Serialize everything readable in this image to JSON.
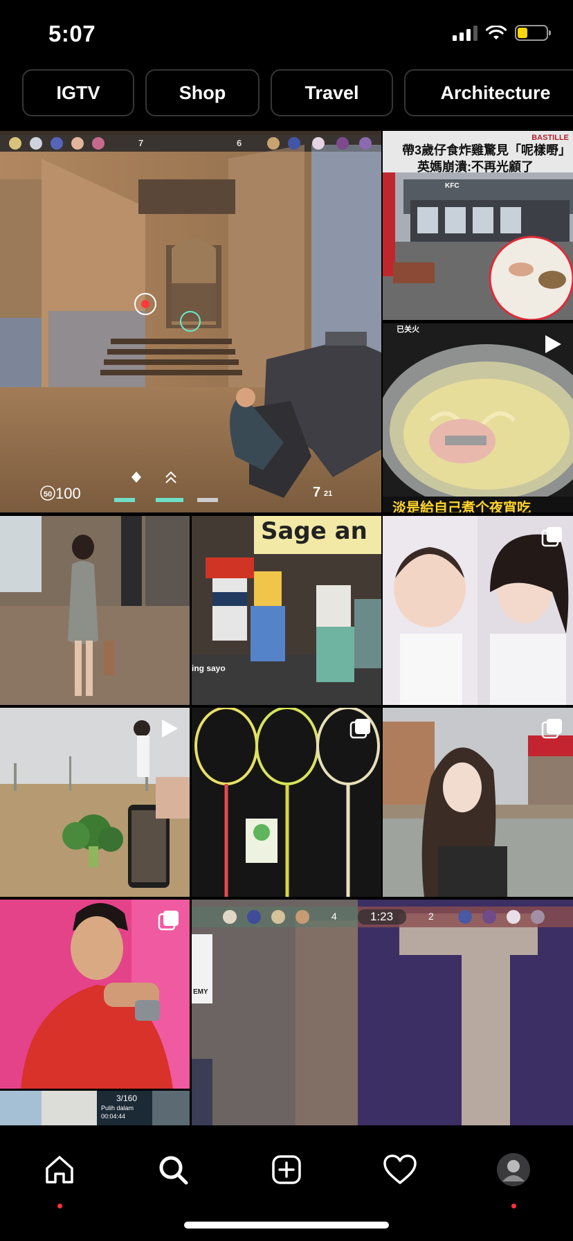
{
  "status_bar": {
    "time": "5:07"
  },
  "chips": [
    {
      "label": "IGTV"
    },
    {
      "label": "Shop"
    },
    {
      "label": "Travel"
    },
    {
      "label": "Architecture"
    }
  ],
  "posts": {
    "game_hud": {
      "health": "100",
      "shield": "50",
      "ammo": "7",
      "reserve": "21",
      "team_left_score": "7",
      "team_right_score": "6"
    },
    "news": {
      "brand": "BASTILLE",
      "headline_1": "帶3歲仔食炸雞驚見「呢樣嘢」",
      "headline_2": "英媽崩潰:不再光顧了",
      "store_sign": "KFC"
    },
    "noodles": {
      "caption": "淡是給自己煮个夜宵吃",
      "overlay_top": "已关火"
    },
    "roblox": {
      "sign": "Sage an",
      "caption": "ing sayo"
    },
    "small_bottom": {
      "counter": "3/160",
      "line1": "Pulih dalam",
      "line2": "00:04:44"
    },
    "game_hud_2": {
      "timer": "1:23",
      "left_score": "4",
      "right_score": "2",
      "side_text": "EMY"
    }
  },
  "colors": {
    "accent_dot": "#ff3040",
    "battery": "#ffd60a",
    "chip_border": "#363636"
  },
  "nav": {
    "icons": [
      "home-icon",
      "search-icon",
      "create-icon",
      "activity-heart-icon",
      "profile-avatar"
    ]
  }
}
